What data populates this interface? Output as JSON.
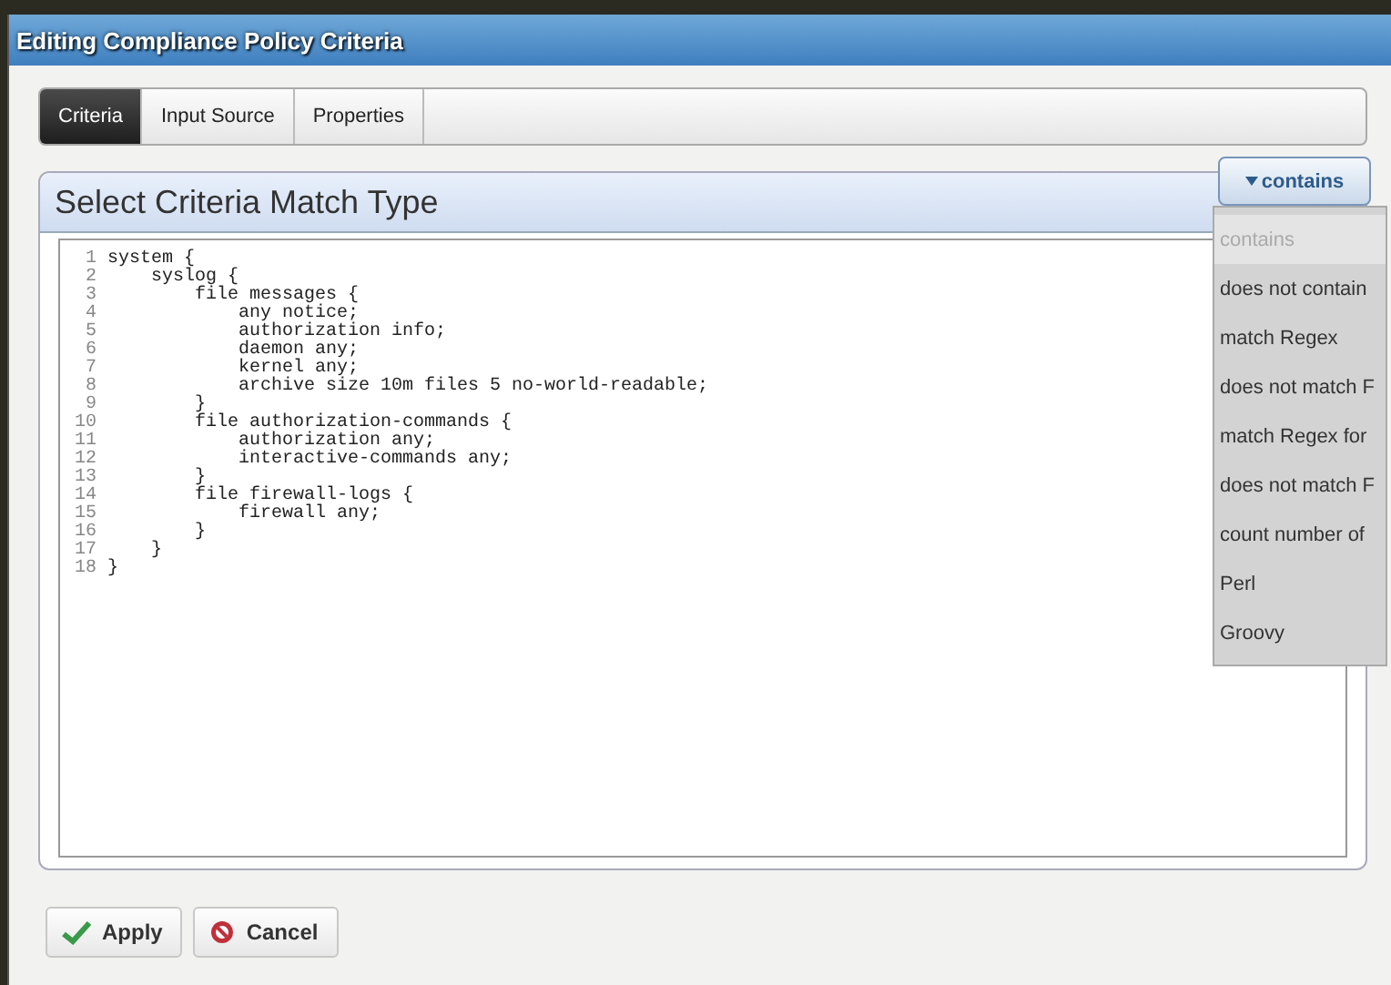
{
  "window": {
    "title": "Editing Compliance Policy Criteria"
  },
  "tabs": [
    {
      "label": "Criteria",
      "selected": true
    },
    {
      "label": "Input Source",
      "selected": false
    },
    {
      "label": "Properties",
      "selected": false
    }
  ],
  "panel": {
    "title": "Select Criteria Match Type"
  },
  "match_type": {
    "value": "contains",
    "expanded": true,
    "options": [
      {
        "label": "contains",
        "selected": true
      },
      {
        "label": "does not contain",
        "selected": false
      },
      {
        "label": "match Regex",
        "selected": false
      },
      {
        "label": "does not match F",
        "selected": false
      },
      {
        "label": "match Regex for",
        "selected": false
      },
      {
        "label": "does not match F",
        "selected": false
      },
      {
        "label": "count number of",
        "selected": false
      },
      {
        "label": "Perl",
        "selected": false
      },
      {
        "label": "Groovy",
        "selected": false
      }
    ]
  },
  "editor": {
    "lines": [
      {
        "number": "1",
        "text": "system {"
      },
      {
        "number": "2",
        "text": "    syslog {"
      },
      {
        "number": "3",
        "text": "        file messages {"
      },
      {
        "number": "4",
        "text": "            any notice;"
      },
      {
        "number": "5",
        "text": "            authorization info;"
      },
      {
        "number": "6",
        "text": "            daemon any;"
      },
      {
        "number": "7",
        "text": "            kernel any;"
      },
      {
        "number": "8",
        "text": "            archive size 10m files 5 no-world-readable;"
      },
      {
        "number": "9",
        "text": "        }"
      },
      {
        "number": "10",
        "text": "        file authorization-commands {"
      },
      {
        "number": "11",
        "text": "            authorization any;"
      },
      {
        "number": "12",
        "text": "            interactive-commands any;"
      },
      {
        "number": "13",
        "text": "        }"
      },
      {
        "number": "14",
        "text": "        file firewall-logs {"
      },
      {
        "number": "15",
        "text": "            firewall any;"
      },
      {
        "number": "16",
        "text": "        }"
      },
      {
        "number": "17",
        "text": "    }"
      },
      {
        "number": "18",
        "text": "}"
      }
    ]
  },
  "buttons": [
    {
      "kind": "apply",
      "label": "Apply"
    },
    {
      "kind": "cancel",
      "label": "Cancel"
    }
  ]
}
